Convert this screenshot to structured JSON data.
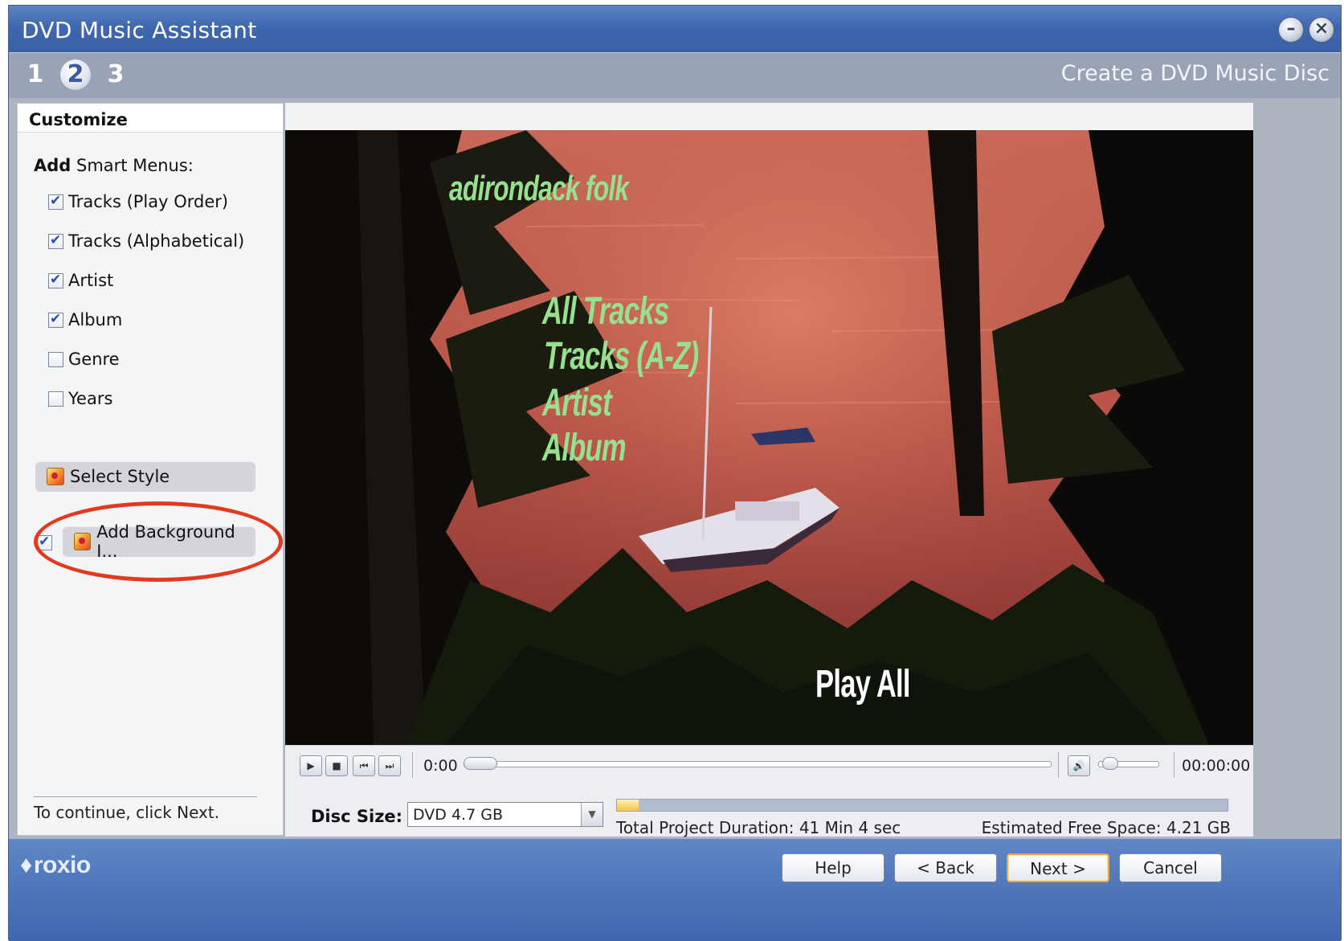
{
  "window": {
    "title": "DVD Music Assistant"
  },
  "steps": {
    "items": [
      "1",
      "2",
      "3"
    ],
    "active_index": 1,
    "title": "Create a DVD Music Disc"
  },
  "left_panel": {
    "header": "Customize",
    "add_label_bold": "Add",
    "add_label_rest": " Smart Menus:",
    "menus": [
      {
        "label": "Tracks (Play Order)",
        "checked": true
      },
      {
        "label": "Tracks (Alphabetical)",
        "checked": true
      },
      {
        "label": "Artist",
        "checked": true
      },
      {
        "label": "Album",
        "checked": true
      },
      {
        "label": "Genre",
        "checked": false
      },
      {
        "label": "Years",
        "checked": false
      }
    ],
    "select_style_label": "Select Style",
    "add_background_label": "Add Background I...",
    "add_background_checked": true,
    "footer": "To continue, click Next."
  },
  "preview": {
    "disc_title": "adirondack folk",
    "menu_items": [
      "All Tracks",
      "Tracks (A-Z)",
      "Artist",
      "Album"
    ],
    "play_all": "Play All"
  },
  "player": {
    "current_time": "0:00",
    "total_time": "00:00:00",
    "buttons": [
      "play-icon",
      "stop-icon",
      "skip-back-icon",
      "skip-forward-icon"
    ],
    "position_fraction": 0.0,
    "volume_fraction": 0.1
  },
  "disc": {
    "label": "Disc Size:",
    "size_value": "DVD 4.7 GB",
    "used_fraction": 0.035,
    "duration_text": "Total Project Duration: 41 Min 4 sec",
    "free_space_text": "Estimated Free Space: 4.21 GB"
  },
  "footer": {
    "brand": "roxio",
    "help": "Help",
    "back": "< Back",
    "next": "Next >",
    "cancel": "Cancel"
  },
  "colors": {
    "titlebar": "#4470b5",
    "highlight_ring": "#e23a1f",
    "menu_text": "#98e08f",
    "play_all_text": "#ffffff"
  }
}
